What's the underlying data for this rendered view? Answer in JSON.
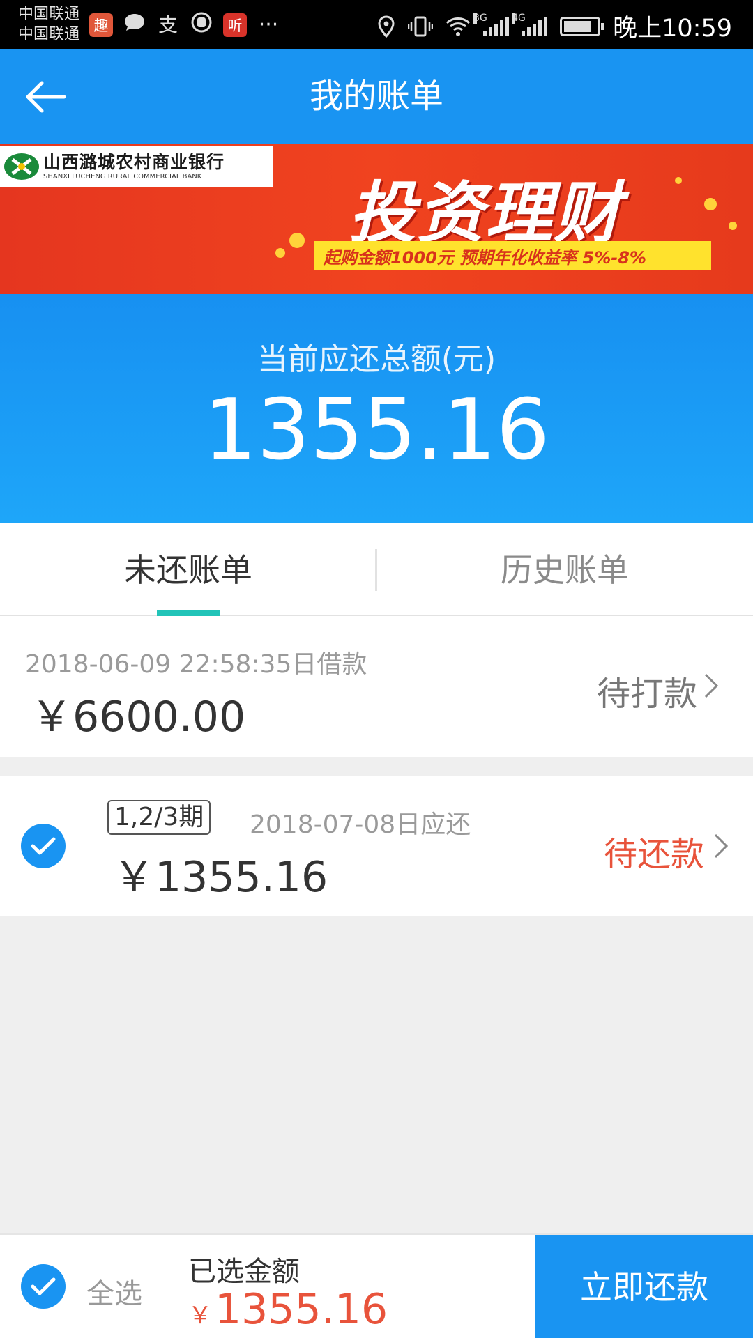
{
  "status_bar": {
    "carrier_1": "中国联通",
    "carrier_2": "中国联通",
    "app_icons": [
      {
        "name": "qu-app-icon",
        "text": "趣",
        "color": "#e0573a"
      },
      {
        "name": "chat-bubble-icon"
      },
      {
        "name": "alipay-icon",
        "text": "支"
      },
      {
        "name": "hand-app-icon"
      },
      {
        "name": "ting-app-icon",
        "text": "听",
        "color": "#d8332a"
      }
    ],
    "more": "···",
    "network_1": "3G",
    "network_2": "4G",
    "time": "晚上10:59",
    "battery_level": 0.85
  },
  "header": {
    "title": "我的账单",
    "back_icon": "back-arrow-icon"
  },
  "banner": {
    "bank_name_cn": "山西潞城农村商业银行",
    "bank_name_en": "SHANXI LUCHENG RURAL COMMERCIAL BANK",
    "promo_title": "投资理财",
    "promo_subtitle": "起购金额1000元   预期年化收益率 5%-8%"
  },
  "summary": {
    "label": "当前应还总额(元)",
    "amount": "1355.16"
  },
  "tabs": [
    {
      "label": "未还账单",
      "active": true
    },
    {
      "label": "历史账单",
      "active": false
    }
  ],
  "bills": [
    {
      "date_text": "2018-06-09 22:58:35日借款",
      "amount": "￥6600.00",
      "status": "待打款"
    },
    {
      "checked": true,
      "period": "1,2/3期",
      "date_text": "2018-07-08日应还",
      "amount": "￥1355.16",
      "status": "待还款"
    }
  ],
  "bottom_bar": {
    "select_all_label": "全选",
    "selected_label": "已选金额",
    "currency": "￥",
    "selected_amount": "1355.16",
    "pay_button": "立即还款"
  },
  "colors": {
    "primary": "#1994f2",
    "accent_teal": "#22c4b8",
    "status_red": "#e8533b",
    "banner_red": "#e5361f"
  }
}
